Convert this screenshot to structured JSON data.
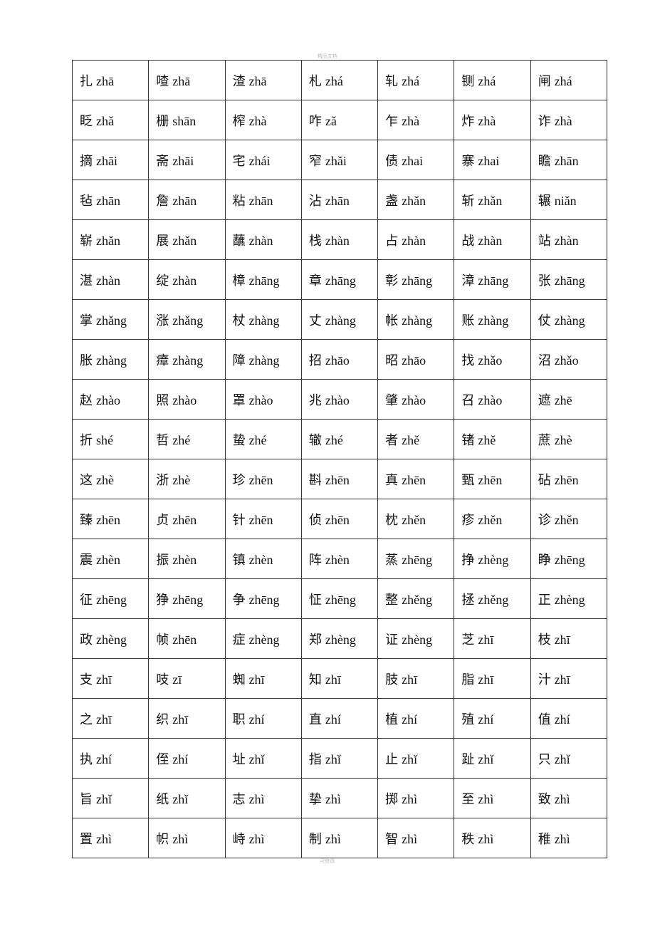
{
  "header": {
    "text": "精品文档"
  },
  "footer": {
    "text": "可修改"
  },
  "table": {
    "rows": [
      [
        [
          "扎",
          "zhā"
        ],
        [
          "喳",
          "zhā"
        ],
        [
          "渣",
          "zhā"
        ],
        [
          "札",
          "zhá"
        ],
        [
          "轧",
          "zhá"
        ],
        [
          "铡",
          "zhá"
        ],
        [
          "闸",
          "zhá"
        ]
      ],
      [
        [
          "眨",
          "zhǎ"
        ],
        [
          "栅",
          "shān"
        ],
        [
          "榨",
          "zhà"
        ],
        [
          "咋",
          "zǎ"
        ],
        [
          "乍",
          "zhà"
        ],
        [
          "炸",
          "zhà"
        ],
        [
          "诈",
          "zhà"
        ]
      ],
      [
        [
          "摘",
          "zhāi"
        ],
        [
          "斋",
          "zhāi"
        ],
        [
          "宅",
          "zhái"
        ],
        [
          "窄",
          "zhǎi"
        ],
        [
          "债",
          "zhai"
        ],
        [
          "寨",
          "zhai"
        ],
        [
          "瞻",
          "zhān"
        ]
      ],
      [
        [
          "毡",
          "zhān"
        ],
        [
          "詹",
          "zhān"
        ],
        [
          "粘",
          "zhān"
        ],
        [
          "沾",
          "zhān"
        ],
        [
          "盏",
          "zhǎn"
        ],
        [
          "斩",
          "zhǎn"
        ],
        [
          "辗",
          "niǎn"
        ]
      ],
      [
        [
          "崭",
          "zhǎn"
        ],
        [
          "展",
          "zhǎn"
        ],
        [
          "蘸",
          "zhàn"
        ],
        [
          "栈",
          "zhàn"
        ],
        [
          "占",
          "zhàn"
        ],
        [
          "战",
          "zhàn"
        ],
        [
          "站",
          "zhàn"
        ]
      ],
      [
        [
          "湛",
          "zhàn"
        ],
        [
          "绽",
          "zhàn"
        ],
        [
          "樟",
          "zhāng"
        ],
        [
          "章",
          "zhāng"
        ],
        [
          "彰",
          "zhāng"
        ],
        [
          "漳",
          "zhāng"
        ],
        [
          "张",
          "zhāng"
        ]
      ],
      [
        [
          "掌",
          "zhǎng"
        ],
        [
          "涨",
          "zhǎng"
        ],
        [
          "杖",
          "zhàng"
        ],
        [
          "丈",
          "zhàng"
        ],
        [
          "帐",
          "zhàng"
        ],
        [
          "账",
          "zhàng"
        ],
        [
          "仗",
          "zhàng"
        ]
      ],
      [
        [
          "胀",
          "zhàng"
        ],
        [
          "瘴",
          "zhàng"
        ],
        [
          "障",
          "zhàng"
        ],
        [
          "招",
          "zhāo"
        ],
        [
          "昭",
          "zhāo"
        ],
        [
          "找",
          "zhǎo"
        ],
        [
          "沼",
          "zhǎo"
        ]
      ],
      [
        [
          "赵",
          "zhào"
        ],
        [
          "照",
          "zhào"
        ],
        [
          "罩",
          "zhào"
        ],
        [
          "兆",
          "zhào"
        ],
        [
          "肇",
          "zhào"
        ],
        [
          "召",
          "zhào"
        ],
        [
          "遮",
          "zhē"
        ]
      ],
      [
        [
          "折",
          "shé"
        ],
        [
          "哲",
          "zhé"
        ],
        [
          "蛰",
          "zhé"
        ],
        [
          "辙",
          "zhé"
        ],
        [
          "者",
          "zhě"
        ],
        [
          "锗",
          "zhě"
        ],
        [
          "蔗",
          "zhè"
        ]
      ],
      [
        [
          "这",
          "zhè"
        ],
        [
          "浙",
          "zhè"
        ],
        [
          "珍",
          "zhēn"
        ],
        [
          "斟",
          "zhēn"
        ],
        [
          "真",
          "zhēn"
        ],
        [
          "甄",
          "zhēn"
        ],
        [
          "砧",
          "zhēn"
        ]
      ],
      [
        [
          "臻",
          "zhēn"
        ],
        [
          "贞",
          "zhēn"
        ],
        [
          "针",
          "zhēn"
        ],
        [
          "侦",
          "zhēn"
        ],
        [
          "枕",
          "zhěn"
        ],
        [
          "疹",
          "zhěn"
        ],
        [
          "诊",
          "zhěn"
        ]
      ],
      [
        [
          "震",
          "zhèn"
        ],
        [
          "振",
          "zhèn"
        ],
        [
          "镇",
          "zhèn"
        ],
        [
          "阵",
          "zhèn"
        ],
        [
          "蒸",
          "zhēng"
        ],
        [
          "挣",
          "zhèng"
        ],
        [
          "睁",
          "zhēng"
        ]
      ],
      [
        [
          "征",
          "zhēng"
        ],
        [
          "狰",
          "zhēng"
        ],
        [
          "争",
          "zhēng"
        ],
        [
          "怔",
          "zhēng"
        ],
        [
          "整",
          "zhěng"
        ],
        [
          "拯",
          "zhěng"
        ],
        [
          "正",
          "zhèng"
        ]
      ],
      [
        [
          "政",
          "zhèng"
        ],
        [
          "帧",
          "zhēn"
        ],
        [
          "症",
          "zhèng"
        ],
        [
          "郑",
          "zhèng"
        ],
        [
          "证",
          "zhèng"
        ],
        [
          "芝",
          "zhī"
        ],
        [
          "枝",
          "zhī"
        ]
      ],
      [
        [
          "支",
          "zhī"
        ],
        [
          "吱",
          "zī"
        ],
        [
          "蜘",
          "zhī"
        ],
        [
          "知",
          "zhī"
        ],
        [
          "肢",
          "zhī"
        ],
        [
          "脂",
          "zhī"
        ],
        [
          "汁",
          "zhī"
        ]
      ],
      [
        [
          "之",
          "zhī"
        ],
        [
          "织",
          "zhī"
        ],
        [
          "职",
          "zhí"
        ],
        [
          "直",
          "zhí"
        ],
        [
          "植",
          "zhí"
        ],
        [
          "殖",
          "zhí"
        ],
        [
          "值",
          "zhí"
        ]
      ],
      [
        [
          "执",
          "zhí"
        ],
        [
          "侄",
          "zhí"
        ],
        [
          "址",
          "zhǐ"
        ],
        [
          "指",
          "zhǐ"
        ],
        [
          "止",
          "zhǐ"
        ],
        [
          "趾",
          "zhǐ"
        ],
        [
          "只",
          "zhǐ"
        ]
      ],
      [
        [
          "旨",
          "zhǐ"
        ],
        [
          "纸",
          "zhǐ"
        ],
        [
          "志",
          "zhì"
        ],
        [
          "挚",
          "zhì"
        ],
        [
          "掷",
          "zhì"
        ],
        [
          "至",
          "zhì"
        ],
        [
          "致",
          "zhì"
        ]
      ],
      [
        [
          "置",
          "zhì"
        ],
        [
          "帜",
          "zhì"
        ],
        [
          "峙",
          "zhì"
        ],
        [
          "制",
          "zhì"
        ],
        [
          "智",
          "zhì"
        ],
        [
          "秩",
          "zhì"
        ],
        [
          "稚",
          "zhì"
        ]
      ]
    ]
  }
}
